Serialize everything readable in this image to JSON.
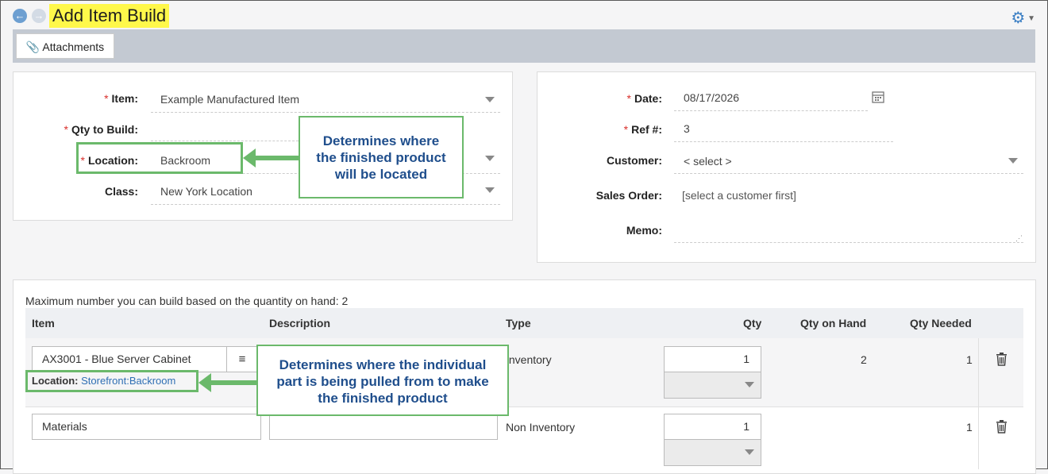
{
  "header": {
    "title": "Add Item Build",
    "back_icon": "arrow-left-icon",
    "forward_icon": "arrow-right-icon",
    "settings_icon": "gear-icon"
  },
  "toolbar": {
    "attachments_label": "Attachments"
  },
  "left_form": {
    "item_label": "Item:",
    "item_value": "Example Manufactured Item",
    "qty_label": "Qty to Build:",
    "qty_value": "",
    "location_label": "Location:",
    "location_value": "Backroom",
    "class_label": "Class:",
    "class_value": "New York Location"
  },
  "right_form": {
    "date_label": "Date:",
    "date_value": "08/17/2026",
    "ref_label": "Ref #:",
    "ref_value": "3",
    "customer_label": "Customer:",
    "customer_value": "< select >",
    "sales_order_label": "Sales Order:",
    "sales_order_value": "[select a customer first]",
    "memo_label": "Memo:",
    "memo_value": ""
  },
  "callouts": {
    "top": [
      "Determines where",
      "the finished product",
      "will be located"
    ],
    "bottom": [
      "Determines where the individual",
      "part is being pulled from to make",
      "the finished product"
    ]
  },
  "lines": {
    "max_note": "Maximum number you can build based on the quantity on hand: 2",
    "headers": {
      "item": "Item",
      "description": "Description",
      "type": "Type",
      "qty": "Qty",
      "qty_on_hand": "Qty on Hand",
      "qty_needed": "Qty Needed"
    },
    "rows": [
      {
        "item": "AX3001 - Blue Server Cabinet",
        "location_label": "Location:",
        "location_value": "Storefront:Backroom",
        "type": "Inventory",
        "qty": "1",
        "qty_on_hand": "2",
        "qty_needed": "1"
      },
      {
        "item": "Materials",
        "type": "Non Inventory",
        "qty": "1",
        "qty_on_hand": "",
        "qty_needed": "1"
      }
    ]
  },
  "colors": {
    "highlight": "#fff84a",
    "callout_border": "#6bb96b",
    "callout_text": "#1f4e8c",
    "link": "#2f6fb4",
    "required": "#d9302c"
  }
}
